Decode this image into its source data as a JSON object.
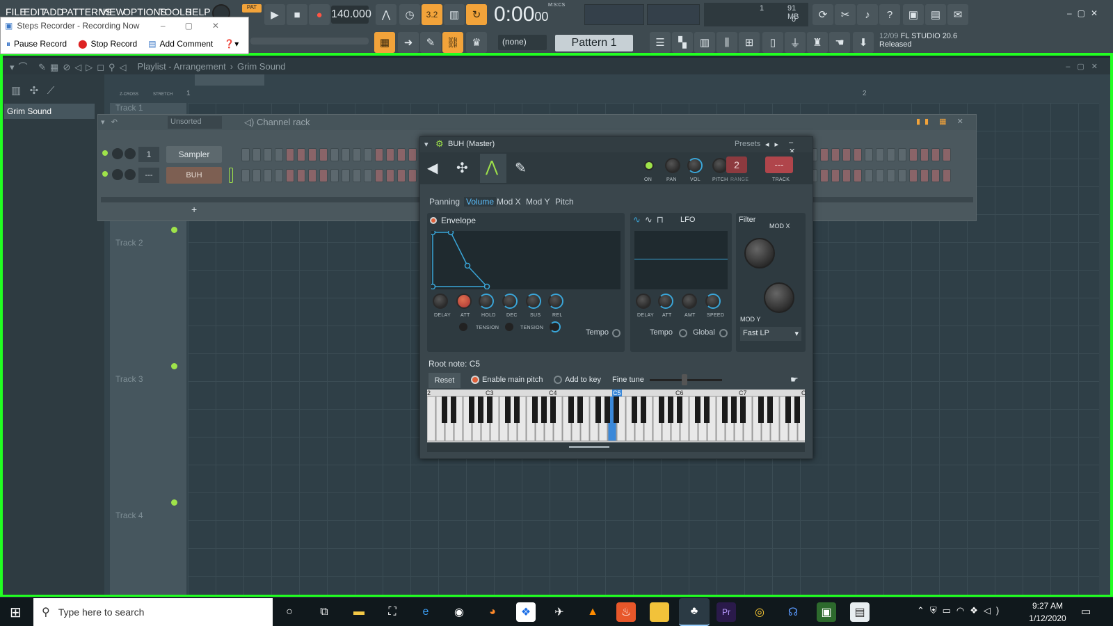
{
  "menu": [
    "FILE",
    "EDIT",
    "ADD",
    "PATTERNS",
    "VIEW",
    "OPTIONS",
    "TOOLS",
    "HELP"
  ],
  "transport": {
    "mode_label": "PAT",
    "tempo": "140.000",
    "time": "0:00",
    "time_small": "00",
    "time_unit": "M:S:CS",
    "pattern": "Pattern 1",
    "snap": "(none)",
    "memory": "91 MB",
    "memory_value": "1",
    "voices": "0"
  },
  "news": {
    "date": "12/09",
    "product": "FL STUDIO 20.6",
    "status": "Released"
  },
  "steps_recorder": {
    "title": "Steps Recorder - Recording Now",
    "pause": "Pause Record",
    "stop": "Stop Record",
    "comment": "Add Comment"
  },
  "playlist": {
    "title": "Playlist - Arrangement",
    "arrow": "›",
    "pattern": "Grim Sound",
    "browser_item": "Grim Sound",
    "zcross": "Z-CROSS",
    "stretch": "STRETCH",
    "bar1": "1",
    "bar2": "2",
    "tracks": [
      "Track 1",
      "Track 2",
      "Track 3",
      "Track 4"
    ]
  },
  "channel_rack": {
    "title": "Channel rack",
    "filter": "Unsorted",
    "channels": [
      {
        "index": "1",
        "name": "Sampler"
      },
      {
        "index": "---",
        "name": "BUH"
      }
    ],
    "add": "+"
  },
  "plugin": {
    "title": "BUH (Master)",
    "presets": "Presets",
    "pitch_range": "2",
    "track": "---",
    "knob_labels": {
      "on": "ON",
      "pan": "PAN",
      "vol": "VOL",
      "pitch": "PITCH",
      "range": "RANGE",
      "track": "TRACK"
    },
    "tabs": [
      "Panning",
      "Volume",
      "Mod X",
      "Mod Y",
      "Pitch"
    ],
    "active_tab": "Volume",
    "envelope_label": "Envelope",
    "lfo_label": "LFO",
    "filter_label": "Filter",
    "mod_x": "MOD X",
    "mod_y": "MOD Y",
    "env_knobs": [
      "DELAY",
      "ATT",
      "HOLD",
      "DEC",
      "SUS",
      "REL"
    ],
    "tension": "TENSION",
    "lfo_knobs": [
      "DELAY",
      "ATT",
      "AMT",
      "SPEED"
    ],
    "tempo": "Tempo",
    "global": "Global",
    "filter_type": "Fast LP",
    "root_note": "Root note: C5",
    "reset": "Reset",
    "enable_pitch": "Enable main pitch",
    "add_key": "Add to key",
    "fine_tune": "Fine tune",
    "octaves": [
      "2",
      "C3",
      "C4",
      "C5",
      "C6",
      "C7",
      "C"
    ],
    "accent": "#3aa6d9"
  },
  "taskbar": {
    "search_placeholder": "Type here to search",
    "time": "9:27 AM",
    "date": "1/12/2020"
  }
}
